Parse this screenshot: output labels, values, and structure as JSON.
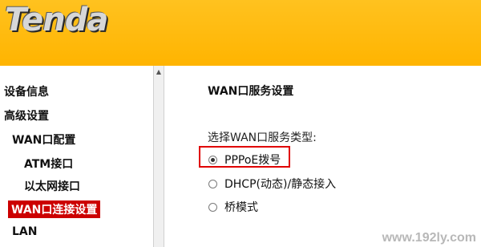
{
  "header": {
    "logo_text": "Tenda"
  },
  "sidebar": {
    "items": [
      {
        "label": "设备信息"
      },
      {
        "label": "高级设置"
      },
      {
        "label": "WAN口配置"
      },
      {
        "label": "ATM接口"
      },
      {
        "label": "以太网接口"
      },
      {
        "label": "WAN口连接设置"
      },
      {
        "label": "LAN"
      }
    ]
  },
  "main": {
    "title": "WAN口服务设置",
    "type_label": "选择WAN口服务类型:",
    "options": [
      {
        "label": "PPPoE拨号",
        "checked": true
      },
      {
        "label": "DHCP(动态)/静态接入",
        "checked": false
      },
      {
        "label": "桥模式",
        "checked": false
      }
    ]
  },
  "watermark": "www.192ly.com",
  "colors": {
    "header": "#ffb400",
    "active_nav": "#cc0000",
    "highlight": "#e00000"
  }
}
